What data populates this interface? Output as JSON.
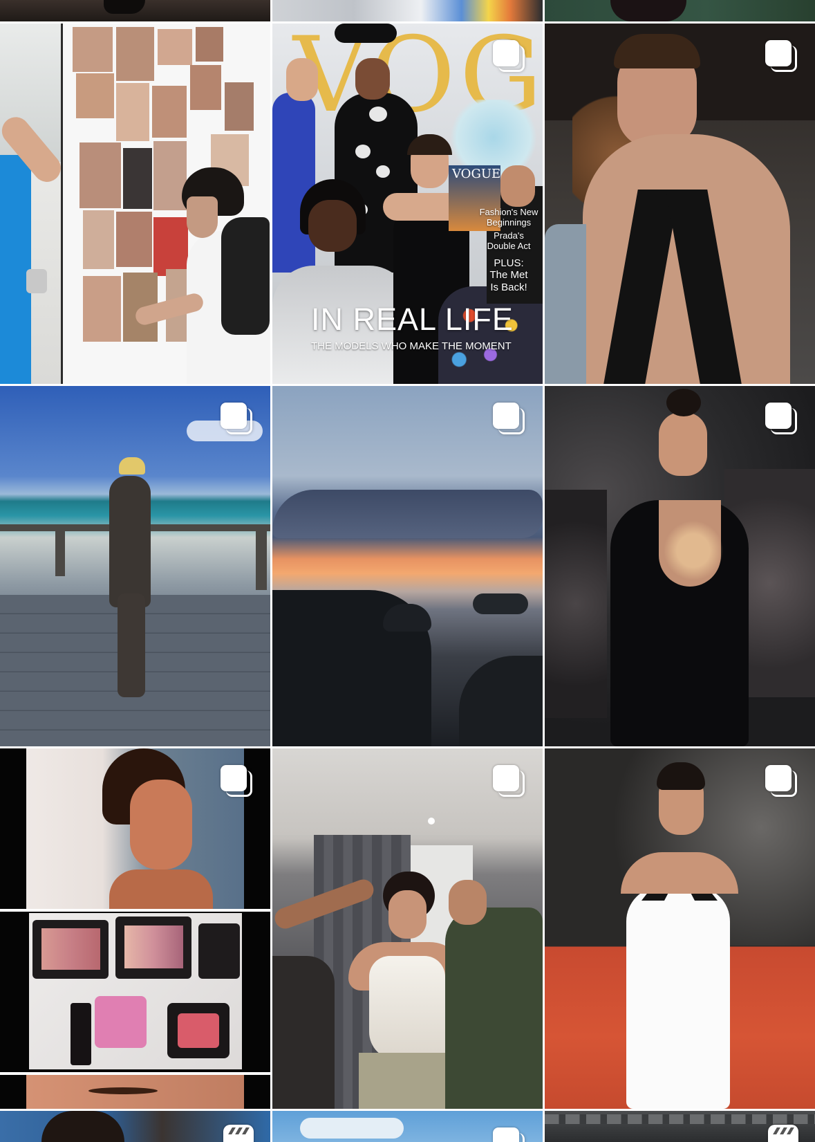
{
  "grid": {
    "columns": 3,
    "tiles": [
      {
        "id": "post-top-left",
        "type": "photo"
      },
      {
        "id": "post-top-middle",
        "type": "photo"
      },
      {
        "id": "post-top-right",
        "type": "photo"
      },
      {
        "id": "post-moodboard",
        "type": "photo"
      },
      {
        "id": "post-vogue-cover",
        "type": "carousel"
      },
      {
        "id": "post-black-sequin",
        "type": "carousel"
      },
      {
        "id": "post-beach-deck",
        "type": "carousel"
      },
      {
        "id": "post-sunset",
        "type": "carousel"
      },
      {
        "id": "post-black-gown-red-carpet",
        "type": "carousel"
      },
      {
        "id": "post-makeup-collage",
        "type": "carousel"
      },
      {
        "id": "post-backstage-corset",
        "type": "carousel"
      },
      {
        "id": "post-white-gown-red-carpet",
        "type": "carousel"
      },
      {
        "id": "post-bottom-left",
        "type": "reel"
      },
      {
        "id": "post-bottom-middle",
        "type": "carousel"
      },
      {
        "id": "post-bottom-right",
        "type": "reel"
      }
    ]
  },
  "vogue_cover": {
    "masthead": "VOGUE",
    "headline": "IN REAL LIFE",
    "subheadline": "THE MODELS WHO MAKE THE MOMENT",
    "side_lines": [
      [
        "Fashion's New",
        "Beginnings"
      ],
      [
        "Prada's",
        "Double Act"
      ],
      [
        "PLUS:",
        "The Met",
        "Is Back!"
      ]
    ],
    "inner_cover_masthead": "VOGUE"
  },
  "icons": {
    "carousel": "multiple-photos-icon",
    "reel": "reel-clapper-icon"
  },
  "colors": {
    "background": "#ffffff",
    "icon": "#ffffff",
    "masthead": "#e7b63b"
  }
}
